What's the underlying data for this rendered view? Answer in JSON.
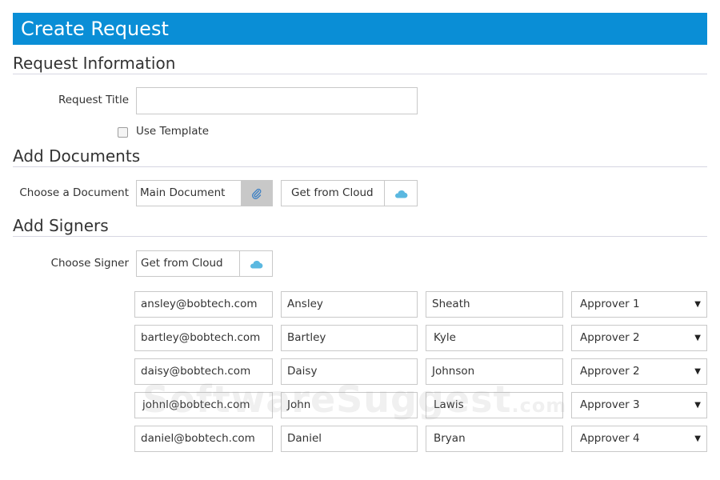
{
  "header": {
    "title": "Create Request"
  },
  "sections": {
    "request_info": "Request Information",
    "add_documents": "Add Documents",
    "add_signers": "Add Signers"
  },
  "request_info": {
    "title_label": "Request Title",
    "title_value": "",
    "use_template_label": "Use Template",
    "use_template_checked": false
  },
  "documents": {
    "choose_label": "Choose a Document",
    "main_document": "Main Document",
    "main_document_icon": "paperclip-icon",
    "cloud_button": "Get from Cloud",
    "cloud_icon": "cloud-icon"
  },
  "signers": {
    "choose_label": "Choose Signer",
    "cloud_button": "Get from Cloud",
    "rows": [
      {
        "email": "ansley@bobtech.com",
        "first": "Ansley",
        "last": "Sheath",
        "role": "Approver 1"
      },
      {
        "email": "bartley@bobtech.com",
        "first": "Bartley",
        "last": "Kyle",
        "role": "Approver 2"
      },
      {
        "email": "daisy@bobtech.com",
        "first": "Daisy",
        "last": "Johnson",
        "role": "Approver 2"
      },
      {
        "email": "johnl@bobtech.com",
        "first": "John",
        "last": "Lawis",
        "role": "Approver 3"
      },
      {
        "email": "daniel@bobtech.com",
        "first": "Daniel",
        "last": "Bryan",
        "role": "Approver 4"
      }
    ]
  },
  "watermark": {
    "text": "SoftwareSuggest",
    "suffix": ".com"
  },
  "colors": {
    "header_bg": "#0a8ed6",
    "cloud_icon": "#5bb8e0",
    "paperclip_icon": "#3a7fc4"
  }
}
